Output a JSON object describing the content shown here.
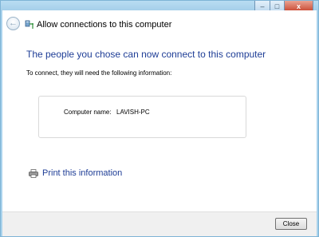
{
  "window": {
    "caption_buttons": {
      "minimize": "–",
      "maximize": "□",
      "close": "x"
    }
  },
  "header": {
    "back_icon": "back-arrow-icon",
    "title_icon": "network-computer-icon",
    "title": "Allow connections to this computer"
  },
  "main": {
    "heading": "The people you chose can now connect to this computer",
    "subtext": "To connect, they will need the following information:",
    "info": {
      "computer_name_label": "Computer name:",
      "computer_name_value": "LAVISH-PC"
    },
    "print": {
      "icon": "printer-icon",
      "label": "Print this information"
    }
  },
  "footer": {
    "close_label": "Close"
  },
  "colors": {
    "accent_text": "#1e3d96",
    "frame": "#a9d2ec",
    "close_caption": "#c8432b"
  }
}
